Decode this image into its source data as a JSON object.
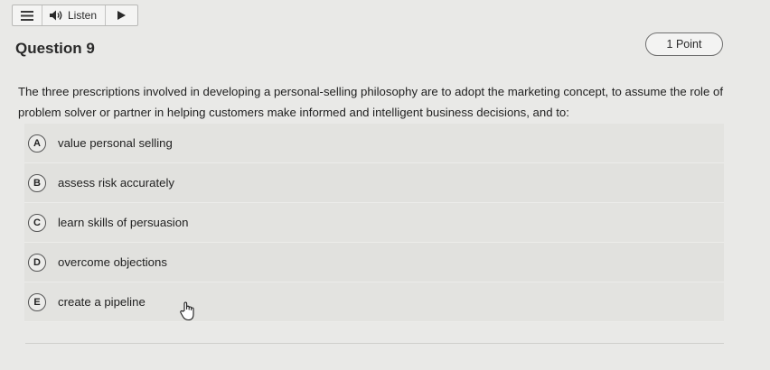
{
  "toolbar": {
    "menu_icon": "hamburger-icon",
    "speaker_icon": "speaker-icon",
    "listen_label": "Listen",
    "play_icon": "play-icon"
  },
  "question": {
    "title": "Question 9",
    "points": "1 Point",
    "text": "The three prescriptions involved in developing a personal-selling philosophy are to adopt the marketing concept, to assume the role of problem solver or partner in helping customers make informed and intelligent business decisions, and to:"
  },
  "options": [
    {
      "letter": "A",
      "text": "value personal selling"
    },
    {
      "letter": "B",
      "text": "assess risk accurately"
    },
    {
      "letter": "C",
      "text": "learn skills of persuasion"
    },
    {
      "letter": "D",
      "text": "overcome objections"
    },
    {
      "letter": "E",
      "text": "create a pipeline"
    }
  ],
  "cursor_icon": "hand-pointer-icon",
  "colors": {
    "background": "#e9e9e7",
    "option_background": "#e1e1de",
    "text": "#222222"
  }
}
